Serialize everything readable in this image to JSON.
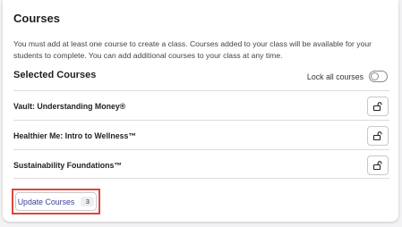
{
  "page": {
    "title": "Courses",
    "description": "You must add at least one course to create a class. Courses added to your class will be available for your students to complete. You can add additional courses to your class at any time."
  },
  "selected_courses": {
    "heading": "Selected Courses",
    "lock_all_label": "Lock all courses",
    "lock_all_enabled": false,
    "items": [
      {
        "label": "Vault: Understanding Money®",
        "icon": "unlock-icon"
      },
      {
        "label": "Healthier Me: Intro to Wellness™",
        "icon": "unlock-icon"
      },
      {
        "label": "Sustainability Foundations™",
        "icon": "unlock-icon"
      }
    ]
  },
  "footer": {
    "update_label": "Update Courses",
    "update_count": "3"
  },
  "colors": {
    "accent": "#3b3f9a",
    "highlight": "#e0453b"
  }
}
